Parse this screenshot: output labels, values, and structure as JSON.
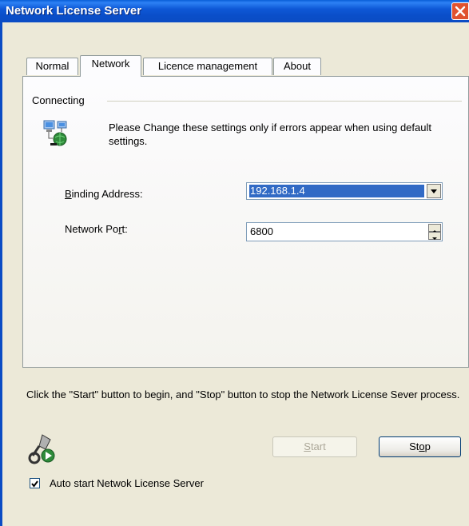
{
  "window": {
    "title": "Network License Server"
  },
  "tabs": [
    {
      "label": "Normal",
      "active": false
    },
    {
      "label": "Network",
      "active": true
    },
    {
      "label": "Licence management",
      "active": false
    },
    {
      "label": "About",
      "active": false
    }
  ],
  "group": {
    "label": "Connecting",
    "info": "Please Change these settings only if errors appear when using default settings."
  },
  "fields": {
    "binding": {
      "label_mnemonic": "B",
      "label_rest": "inding Address:",
      "value": "192.168.1.4"
    },
    "port": {
      "label_pre": "Network Po",
      "label_mnemonic": "r",
      "label_post": "t:",
      "value": "6800"
    }
  },
  "footer": {
    "instructions": "Click the \"Start\" button to begin, and \"Stop\" button to stop the Network License Sever process.",
    "start_mnemonic": "S",
    "start_rest": "tart",
    "stop_pre": "St",
    "stop_mnemonic": "o",
    "stop_post": "p",
    "start_enabled": false,
    "autostart_label": "Auto start Netwok License Server",
    "autostart_checked": true
  },
  "icons": {
    "close": "close-icon",
    "network": "network-computers-icon",
    "key": "key-service-icon",
    "combo_arrow": "chevron-down-icon"
  }
}
